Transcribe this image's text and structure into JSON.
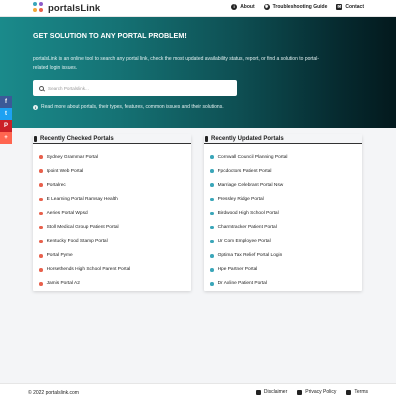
{
  "header": {
    "logo_text": "portalsLink",
    "nav": [
      {
        "label": "About",
        "icon": "info-icon"
      },
      {
        "label": "Troubleshooting Guide",
        "icon": "wrench-icon"
      },
      {
        "label": "Contact",
        "icon": "envelope-icon"
      }
    ]
  },
  "hero": {
    "title": "GET SOLUTION TO ANY PORTAL PROBLEM!",
    "description": "portalsLink is an online tool to search any portal link, check the most updated availability status, report, or find a solution to portal-related login issues.",
    "search_placeholder": "Search Portalslink...",
    "note": "Read more about portals, their types, features, common issues and their solutions."
  },
  "social": [
    {
      "name": "facebook",
      "glyph": "f",
      "color": "#3b5998"
    },
    {
      "name": "twitter",
      "glyph": "t",
      "color": "#1da1f2"
    },
    {
      "name": "pinterest",
      "glyph": "P",
      "color": "#cb2027"
    },
    {
      "name": "share",
      "glyph": "+",
      "color": "#ff6550"
    }
  ],
  "recent_checked": {
    "title": "Recently Checked Portals",
    "dot_color": "#e8604c",
    "items": [
      "Sydney Grammar Portal",
      "Ipoint Web Portal",
      "Portalrec",
      "E Learning Portal Ramsay Health",
      "Aeries Portal Wpsd",
      "Stoll Medical Group Patient Portal",
      "Kentucky Food Stamp Portal",
      "Portal Pyme",
      "Horsethends High School Parent Portal",
      "Jamis Portal A2"
    ]
  },
  "recent_updated": {
    "title": "Recently Updated Portals",
    "dot_color": "#3aa6b9",
    "items": [
      "Cornwall Council Planning Portal",
      "Fpcdoctors Patient Portal",
      "Marriage Celebrant Portal Nsw",
      "Pressley Ridge Portal",
      "Birdwood High School Portal",
      "Charmtracker Patient Portal",
      "Ur Com Employee Portal",
      "Optima Tax Relief Portal Login",
      "Hpe Partner Portal",
      "Dr Axline Patient Portal"
    ]
  },
  "footer": {
    "copyright": "© 2022 portalslink.com",
    "links": [
      {
        "label": "Disclaimer",
        "icon": "megaphone-icon"
      },
      {
        "label": "Privacy Policy",
        "icon": "lock-icon"
      },
      {
        "label": "Terms",
        "icon": "gavel-icon"
      }
    ]
  }
}
